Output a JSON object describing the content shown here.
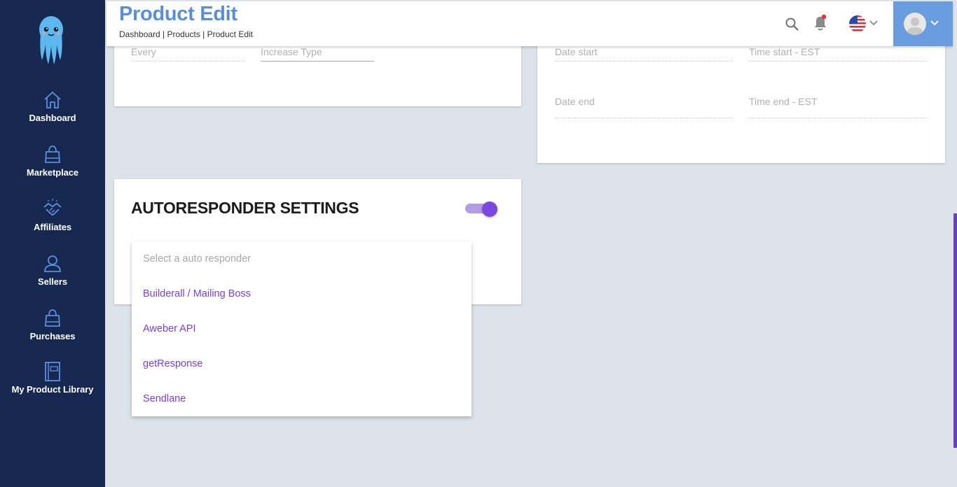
{
  "header": {
    "title": "Product Edit",
    "breadcrumb": "Dashboard | Products | Product Edit"
  },
  "sidebar": {
    "items": [
      {
        "label": "Dashboard",
        "icon": "home-icon"
      },
      {
        "label": "Marketplace",
        "icon": "shopping-bag-icon"
      },
      {
        "label": "Affiliates",
        "icon": "handshake-icon"
      },
      {
        "label": "Sellers",
        "icon": "user-icon"
      },
      {
        "label": "Purchases",
        "icon": "shopping-bag-icon"
      },
      {
        "label": "My Product Library",
        "icon": "book-icon"
      }
    ]
  },
  "left_card": {
    "every_label": "Every",
    "increase_type_label": "Increase Type"
  },
  "right_card": {
    "date_start_label": "Date start",
    "time_start_label": "Time start - EST",
    "date_end_label": "Date end",
    "time_end_label": "Time end - EST"
  },
  "autoresponder": {
    "title": "AUTORESPONDER SETTINGS",
    "enabled": true,
    "select_placeholder": "Select a auto responder",
    "options": [
      "Builderall / Mailing Boss",
      "Aweber API",
      "getResponse",
      "Sendlane"
    ]
  },
  "colors": {
    "sidebar_bg": "#172850",
    "title_blue": "#5a8fd8",
    "accent_purple": "#7a48e0",
    "notification_dot": "#e53935"
  }
}
